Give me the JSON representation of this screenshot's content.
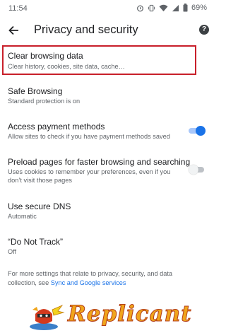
{
  "status_bar": {
    "time": "11:54",
    "battery": "69%",
    "icons": [
      "alarm-icon",
      "vibrate-icon",
      "wifi-icon",
      "signal-icon",
      "battery-icon"
    ]
  },
  "app_bar": {
    "title": "Privacy and security",
    "back_icon": "arrow-back-icon",
    "help_icon": "help-icon"
  },
  "settings": [
    {
      "title": "Clear browsing data",
      "subtitle": "Clear history, cookies, site data, cache…"
    },
    {
      "title": "Safe Browsing",
      "subtitle": "Standard protection is on"
    },
    {
      "title": "Access payment methods",
      "subtitle": "Allow sites to check if you have payment methods saved",
      "toggle": true
    },
    {
      "title": "Preload pages for faster browsing and searching",
      "subtitle": "Uses cookies to remember your preferences, even if you don’t visit those pages",
      "toggle": false
    },
    {
      "title": "Use secure DNS",
      "subtitle": "Automatic"
    },
    {
      "title": "“Do Not Track”",
      "subtitle": "Off"
    }
  ],
  "footer": {
    "text": "For more settings that relate to privacy, security, and data collection, see ",
    "link": "Sync and Google services"
  },
  "watermark": {
    "text": "Replicant"
  },
  "colors": {
    "accent": "#1a73e8",
    "highlight_border": "#c81f2a",
    "watermark_fill": "#f0a51b"
  }
}
